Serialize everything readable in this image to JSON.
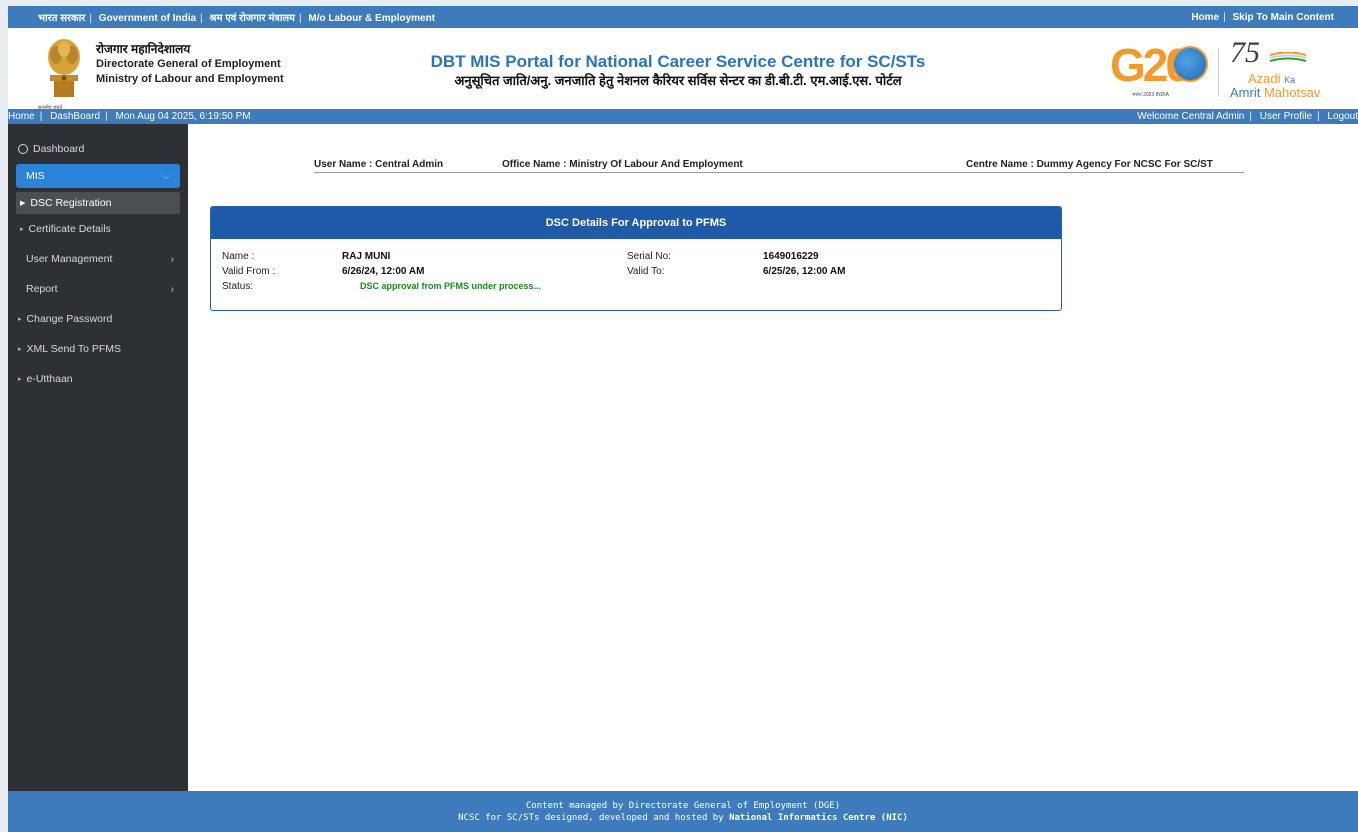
{
  "gov_strip": {
    "left": [
      "भारत सरकार",
      "Government of India",
      "श्रम एवं रोजगार मंत्रालय",
      "M/o Labour & Employment"
    ],
    "right": [
      "Home",
      "Skip To Main Content"
    ]
  },
  "header": {
    "emblem_caption": "सत्यमेव जयते",
    "org_hi": "रोजगार महानिदेशालय",
    "org_en1": "Directorate General of Employment",
    "org_en2": "Ministry of Labour and Employment",
    "portal_title_en": "DBT MIS Portal for National Career Service Centre for SC/STs",
    "portal_title_hi": "अनुसूचित जाति/अनु. जनजाति हेतु नेशनल कैरियर सर्विस सेन्टर का डी.बी.टी. एम.आई.एस. पोर्टल",
    "g20_text": "G20",
    "g20_sub": "भारत 2023 INDIA",
    "azadi_num": "75",
    "azadi_word": "Azadi",
    "azadi_ka": "Ka",
    "azadi_amrit": "Amrit",
    "azadi_mahotsav": "Mahotsav"
  },
  "nav_strip": {
    "left": [
      "Home",
      "DashBoard",
      "Mon Aug 04 2025, 6:19:50 PM"
    ],
    "right": [
      "Welcome Central Admin",
      "User Profile",
      "Logout"
    ]
  },
  "sidebar": {
    "dashboard": "Dashboard",
    "mis": "MIS",
    "dsc_registration": "DSC Registration",
    "certificate_details": "Certificate Details",
    "user_management": "User Management",
    "report": "Report",
    "change_password": "Change Password",
    "xml_send": "XML Send To PFMS",
    "e_utthaan": "e-Utthaan"
  },
  "user_info": {
    "user_name": "User Name : Central Admin",
    "office_name": "Office Name : Ministry Of Labour And Employment",
    "centre_name": "Centre Name : Dummy Agency For NCSC For SC/ST"
  },
  "panel": {
    "title": "DSC Details For Approval to PFMS",
    "name_label": "Name :",
    "name_value": "RAJ MUNI",
    "serial_label": "Serial No:",
    "serial_value": "1649016229",
    "valid_from_label": "Valid From :",
    "valid_from_value": "6/26/24, 12:00 AM",
    "valid_to_label": "Valid To:",
    "valid_to_value": "6/25/26, 12:00 AM",
    "status_label": "Status:",
    "status_value": "DSC approval from PFMS under process..."
  },
  "footer": {
    "line1": "Content managed by Directorate General of Employment (DGE)",
    "line2_prefix": "NCSC for SC/STs designed, developed and hosted by",
    "line2_bold": "National Informatics Centre (NIC)"
  },
  "colors": {
    "brand_blue": "#3e7bbd",
    "sidebar_bg": "#2d3133",
    "active_blue": "#2a83d8",
    "panel_head": "#1e5aa8",
    "status_green": "#1b8a1b",
    "g20_orange": "#f29a2e"
  }
}
